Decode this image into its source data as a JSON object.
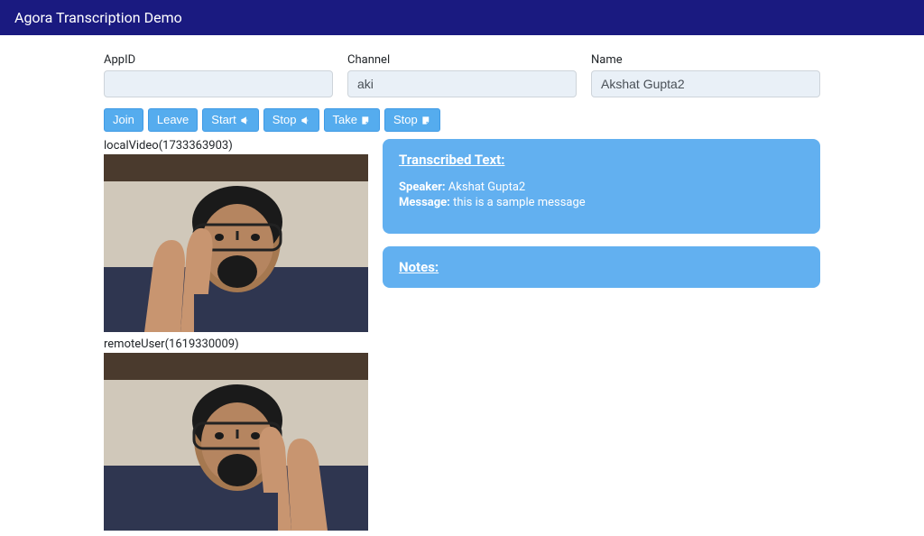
{
  "header": {
    "title": "Agora Transcription Demo"
  },
  "form": {
    "appid_label": "AppID",
    "appid_value": "",
    "channel_label": "Channel",
    "channel_value": "aki",
    "name_label": "Name",
    "name_value": "Akshat Gupta2"
  },
  "buttons": {
    "join": "Join",
    "leave": "Leave",
    "start": "Start",
    "stop": "Stop",
    "take": "Take",
    "stop2": "Stop"
  },
  "videos": {
    "local_label": "localVideo(1733363903)",
    "remote_label": "remoteUser(1619330009)"
  },
  "transcribed": {
    "title": "Transcribed Text:",
    "speaker_label": "Speaker:",
    "speaker_value": "Akshat Gupta2",
    "message_label": "Message:",
    "message_value": "this is a sample message"
  },
  "notes": {
    "title": "Notes:"
  }
}
